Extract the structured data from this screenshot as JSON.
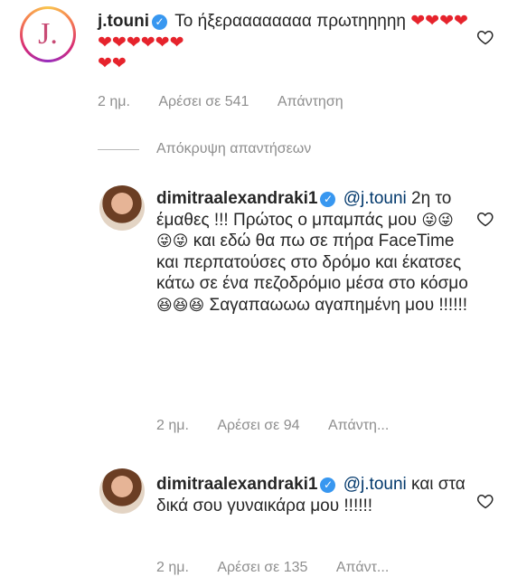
{
  "comments": [
    {
      "username": "j.touni",
      "verified": true,
      "text": "Το ήξεραααααααα πρωτηηηηη",
      "hearts_line1": "❤❤❤❤❤❤❤❤❤❤",
      "hearts_line2": "❤❤",
      "time": "2 ημ.",
      "likes": "Αρέσει σε 541",
      "reply": "Απάντηση"
    },
    {
      "username": "dimitraalexandraki1",
      "verified": true,
      "mention": "@j.touni",
      "text_a": "2η το έμαθες !!! Πρώτος ο μπαμπάς μου",
      "emoji_a": "😜😜😜😜",
      "text_b": "και εδώ θα πω σε πήρα FaceTime και περπατούσες στο δρόμο και έκατσες κάτω σε ένα πεζοδρόμιο μέσα στο κόσμο",
      "emoji_b": "😆😆😆",
      "text_c": "Σαγαπαωωω αγαπημένη μου !!!!!!",
      "time": "2 ημ.",
      "likes": "Αρέσει σε 94",
      "reply": "Απάντη..."
    },
    {
      "username": "dimitraalexandraki1",
      "verified": true,
      "mention": "@j.touni",
      "text": "και στα δικά σου γυναικάρα μου !!!!!!",
      "time": "2 ημ.",
      "likes": "Αρέσει σε 135",
      "reply": "Απάντ..."
    }
  ],
  "hide_replies_label": "Απόκρυψη απαντήσεων",
  "icons": {
    "verified": "✓",
    "heart": "heart-outline-icon"
  }
}
